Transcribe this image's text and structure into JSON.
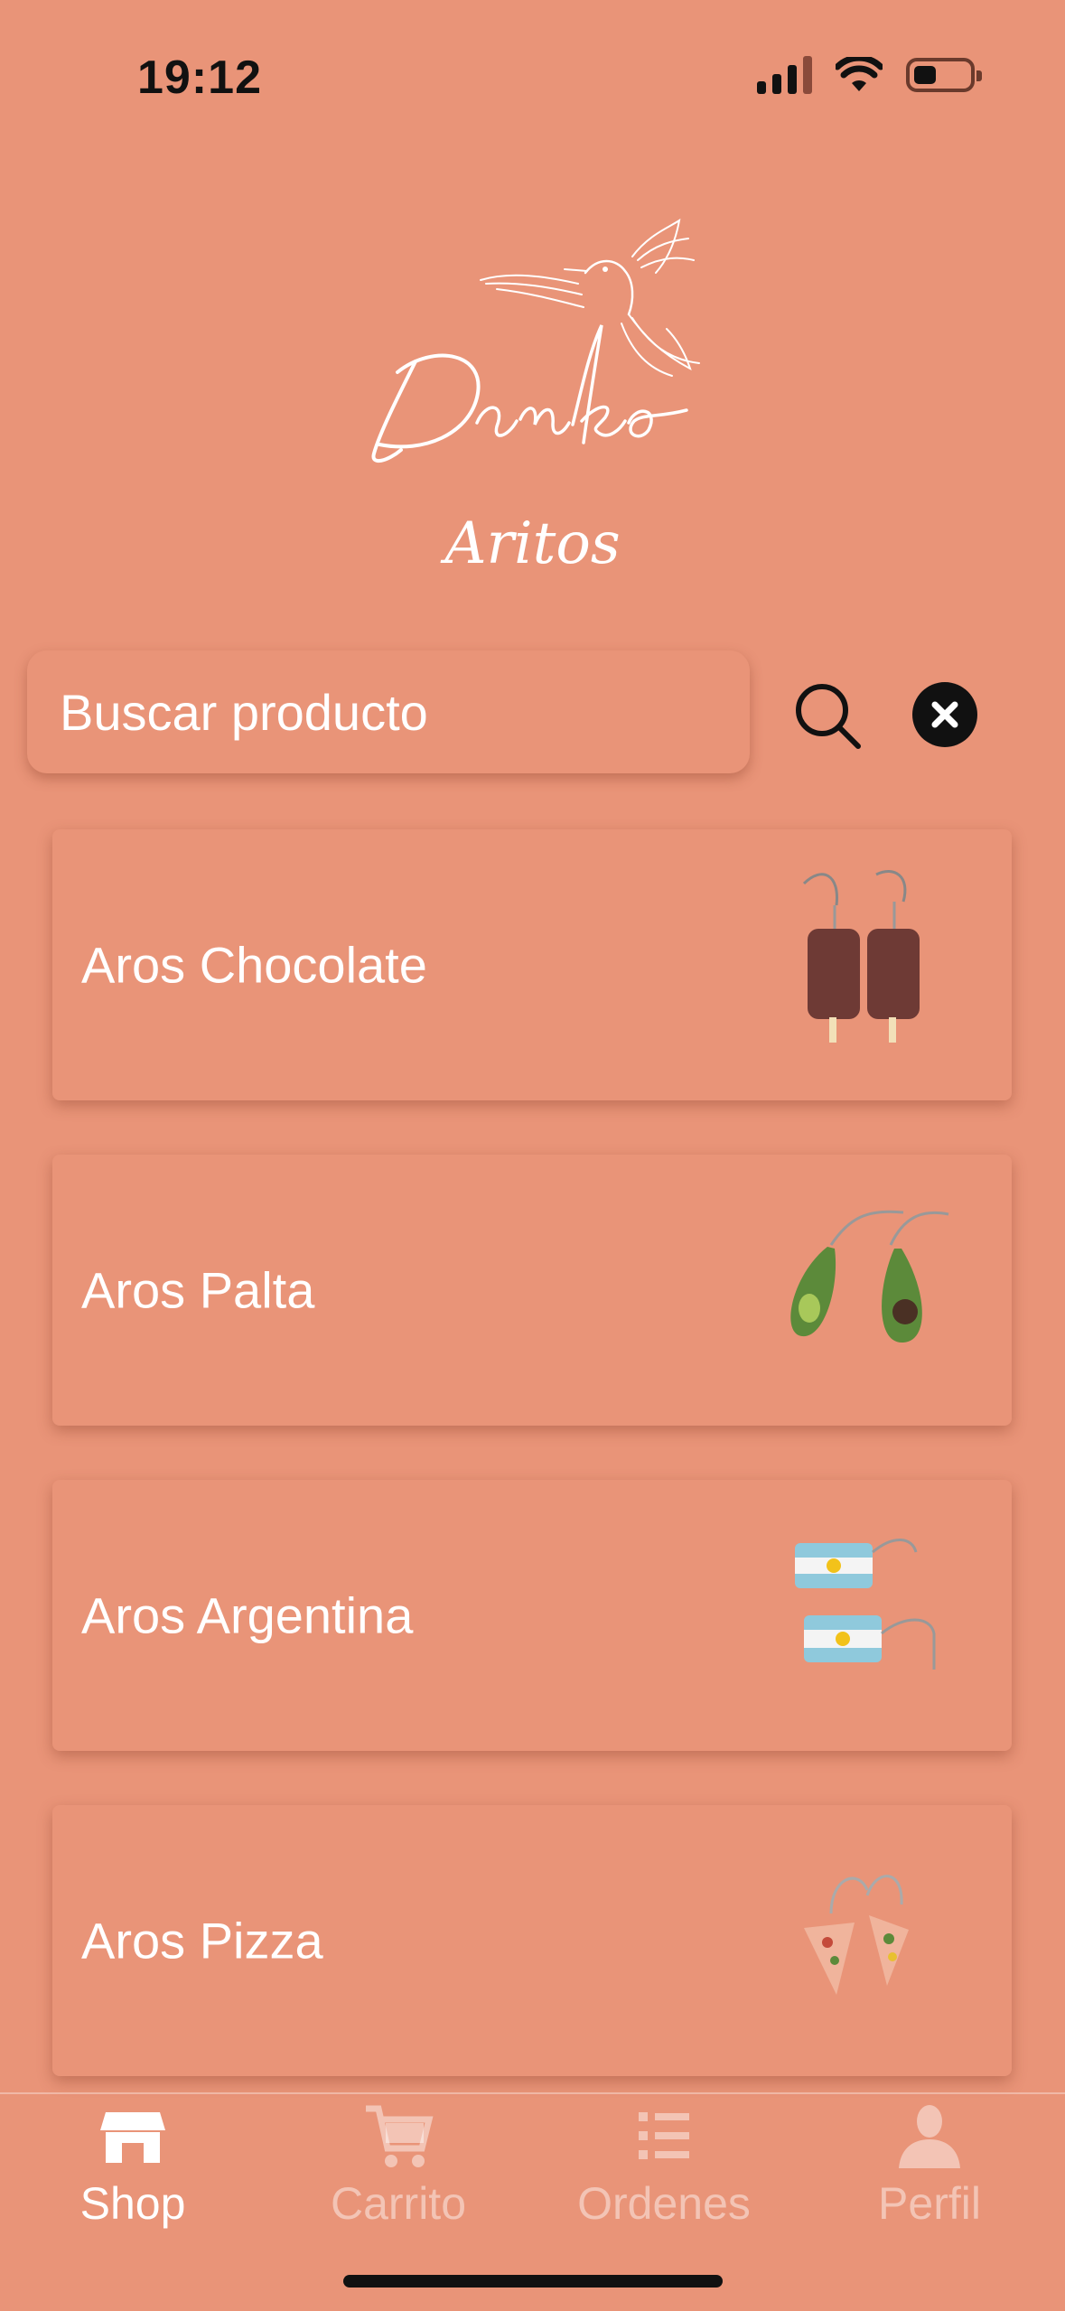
{
  "status_bar": {
    "time": "19:12",
    "battery_level": 0.3
  },
  "brand": {
    "logo_text": "Danko"
  },
  "category": {
    "title": "Aritos"
  },
  "search": {
    "placeholder": "Buscar producto",
    "value": ""
  },
  "products": [
    {
      "name": "Aros Chocolate",
      "thumb": "chocolate-earrings"
    },
    {
      "name": "Aros Palta",
      "thumb": "avocado-earrings"
    },
    {
      "name": "Aros Argentina",
      "thumb": "argentina-flag-earrings"
    },
    {
      "name": "Aros Pizza",
      "thumb": "pizza-earrings"
    }
  ],
  "tabs": [
    {
      "label": "Shop",
      "icon": "shop-icon",
      "active": true
    },
    {
      "label": "Carrito",
      "icon": "cart-icon",
      "active": false
    },
    {
      "label": "Ordenes",
      "icon": "list-icon",
      "active": false
    },
    {
      "label": "Perfil",
      "icon": "profile-icon",
      "active": false
    }
  ],
  "colors": {
    "background": "#E99478",
    "text": "#FFFFFF",
    "status_text": "#111111"
  }
}
